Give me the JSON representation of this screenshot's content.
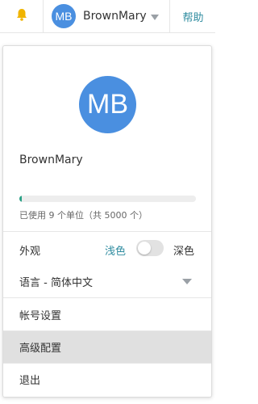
{
  "header": {
    "avatar_initials": "MB",
    "username": "BrownMary",
    "help_label": "帮助",
    "bell_color": "#f0b400"
  },
  "panel": {
    "avatar_initials": "MB",
    "username": "BrownMary",
    "usage": {
      "text": "已使用 9 个单位（共 5000 个）",
      "used": 9,
      "total": 5000
    },
    "appearance": {
      "label": "外观",
      "light_label": "浅色",
      "dark_label": "深色",
      "selected": "浅色"
    },
    "language": {
      "label": "语言 - 简体中文"
    },
    "menu": [
      {
        "label": "帐号设置"
      },
      {
        "label": "高级配置",
        "highlighted": true
      },
      {
        "label": "退出"
      }
    ]
  },
  "colors": {
    "accent": "#2f8ca0",
    "avatar": "#4a8fe0",
    "progress": "#2aa186"
  }
}
